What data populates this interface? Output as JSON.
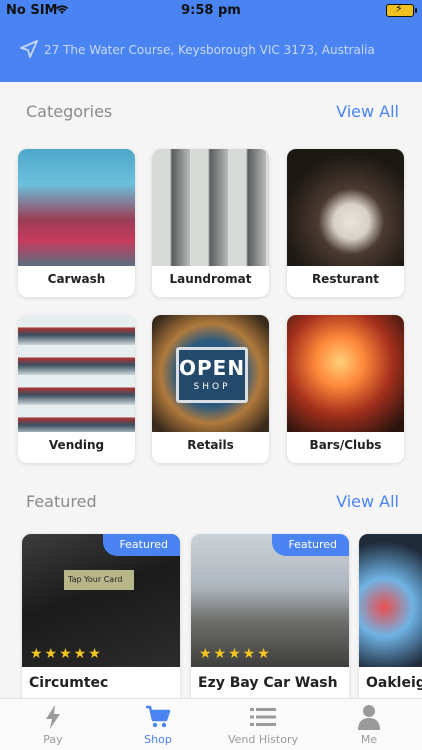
{
  "status_bar": {
    "carrier": "No SIM",
    "time": "9:58 pm"
  },
  "header": {
    "address": "27 The Water Course, Keysborough VIC 3173, Australia"
  },
  "categories": {
    "title": "Categories",
    "view_all": "View All",
    "items": [
      {
        "label": "Carwash"
      },
      {
        "label": "Laundromat"
      },
      {
        "label": "Resturant"
      },
      {
        "label": "Vending"
      },
      {
        "label": "Retails"
      },
      {
        "label": "Bars/Clubs"
      }
    ]
  },
  "featured": {
    "title": "Featured",
    "view_all": "View All",
    "badge": "Featured",
    "items": [
      {
        "name": "Circumtec",
        "rating": 5,
        "screen_text": "Tap Your Card"
      },
      {
        "name": "Ezy Bay Car Wash",
        "rating": 5
      },
      {
        "name": "Oakleigh"
      }
    ]
  },
  "sign": {
    "line1": "OPEN",
    "line2": "SHOP"
  },
  "tabs": [
    {
      "label": "Pay",
      "icon": "bolt-icon"
    },
    {
      "label": "Shop",
      "icon": "cart-icon",
      "active": true
    },
    {
      "label": "Vend History",
      "icon": "list-icon"
    },
    {
      "label": "Me",
      "icon": "person-icon"
    }
  ],
  "colors": {
    "accent": "#4a84f2",
    "star": "#f3c623"
  }
}
